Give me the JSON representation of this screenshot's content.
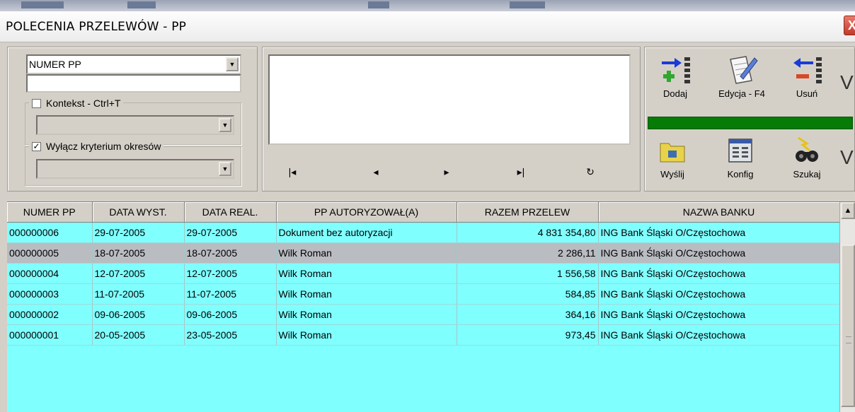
{
  "window": {
    "title": "POLECENIA PRZELEWÓW - PP",
    "close_glyph": "X"
  },
  "filter": {
    "field_select": {
      "value": "NUMER PP"
    },
    "search_value": "",
    "context_checkbox": {
      "label": "Kontekst - Ctrl+T",
      "checked": false,
      "mark": ""
    },
    "context_select": {
      "value": ""
    },
    "period_checkbox": {
      "label": "Wyłącz kryterium okresów",
      "checked": true,
      "mark": "✓"
    },
    "period_select": {
      "value": ""
    }
  },
  "memo_text": "",
  "navigation": {
    "first": "|◂",
    "prev": "◂",
    "next": "▸",
    "last": "▸|",
    "refresh": "↻"
  },
  "actions": {
    "add": {
      "label": "Dodaj",
      "icon": "add-row-icon"
    },
    "edit": {
      "label": "Edycja - F4",
      "icon": "edit-document-icon"
    },
    "delete": {
      "label": "Usuń",
      "icon": "remove-row-icon"
    },
    "cut_letter_1": "V",
    "send": {
      "label": "Wyślij",
      "icon": "folder-icon"
    },
    "config": {
      "label": "Konfig",
      "icon": "config-window-icon"
    },
    "search": {
      "label": "Szukaj",
      "icon": "binoculars-icon"
    },
    "cut_letter_2": "V",
    "progress_percent": 100,
    "progress_color": "#067b06"
  },
  "table": {
    "columns": [
      "NUMER PP",
      "DATA WYST.",
      "DATA REAL.",
      "PP AUTORYZOWAŁ(A)",
      "RAZEM PRZELEW",
      "NAZWA BANKU"
    ],
    "selected_row": 1,
    "row_color": "#80ffff",
    "selected_color": "#b9bcc1",
    "rows": [
      {
        "numer": "000000006",
        "data_wyst": "29-07-2005",
        "data_real": "29-07-2005",
        "autoryzowal": "Dokument bez autoryzacji",
        "razem": "4 831 354,80",
        "bank": "ING Bank Śląski  O/Częstochowa"
      },
      {
        "numer": "000000005",
        "data_wyst": "18-07-2005",
        "data_real": "18-07-2005",
        "autoryzowal": "Wilk Roman",
        "razem": "2 286,11",
        "bank": "ING Bank Śląski  O/Częstochowa"
      },
      {
        "numer": "000000004",
        "data_wyst": "12-07-2005",
        "data_real": "12-07-2005",
        "autoryzowal": "Wilk Roman",
        "razem": "1 556,58",
        "bank": "ING Bank Śląski  O/Częstochowa"
      },
      {
        "numer": "000000003",
        "data_wyst": "11-07-2005",
        "data_real": "11-07-2005",
        "autoryzowal": "Wilk Roman",
        "razem": "584,85",
        "bank": "ING Bank Śląski  O/Częstochowa"
      },
      {
        "numer": "000000002",
        "data_wyst": "09-06-2005",
        "data_real": "09-06-2005",
        "autoryzowal": "Wilk Roman",
        "razem": "364,16",
        "bank": "ING Bank Śląski  O/Częstochowa"
      },
      {
        "numer": "000000001",
        "data_wyst": "20-05-2005",
        "data_real": "23-05-2005",
        "autoryzowal": "Wilk Roman",
        "razem": "973,45",
        "bank": "ING Bank Śląski  O/Częstochowa"
      }
    ]
  }
}
